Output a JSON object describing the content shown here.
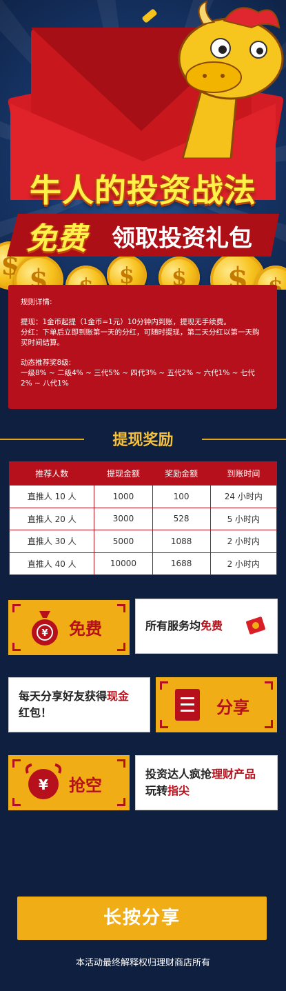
{
  "hero": {
    "title": "牛人的投资战法",
    "subtitle_free": "免费",
    "subtitle_rest": "领取投资礼包",
    "coin_symbol": "$"
  },
  "rules": {
    "heading": "规则详情:",
    "withdraw": "提现：1金币起提（1金币=1元）10分钟内到账，提现无手续费。",
    "dividend": "分红：下单后立即到账第一天的分红，可随时提现，第二天分红以第一天购买时间结算。",
    "referral_heading": "动态推荐奖8级:",
    "referral_levels": "一级8% ~ 二级4% ~ 三代5% ~ 四代3% ~ 五代2% ~ 六代1% ~ 七代2% ~ 八代1%"
  },
  "section_title": "提现奖励",
  "table": {
    "headers": [
      "推荐人数",
      "提现金额",
      "奖励金额",
      "到账时间"
    ],
    "rows": [
      [
        "直推人 10 人",
        "1000",
        "100",
        "24 小时内"
      ],
      [
        "直推人 20 人",
        "3000",
        "528",
        "5 小时内"
      ],
      [
        "直推人 30 人",
        "5000",
        "1088",
        "2 小时内"
      ],
      [
        "直推人 40 人",
        "10000",
        "1688",
        "2 小时内"
      ]
    ]
  },
  "features": {
    "free_label": "免费",
    "free_text_a": "所有服务均",
    "free_text_b": "免费",
    "share_label": "分享",
    "share_text_a": "每天分享好友获得",
    "share_text_b": "现金",
    "share_text_c": "红包！",
    "grab_label": "抢空",
    "grab_text_a": "投资达人疯抢",
    "grab_text_b": "理财产品",
    "grab_text_c": "玩转",
    "grab_text_d": "指尖",
    "yen_symbol": "¥"
  },
  "share_button": "长按分享",
  "footer": "本活动最终解释权归理财商店所有",
  "colors": {
    "accent_red": "#b5101b",
    "gold": "#f1ad15",
    "background": "#0f1f3f"
  }
}
